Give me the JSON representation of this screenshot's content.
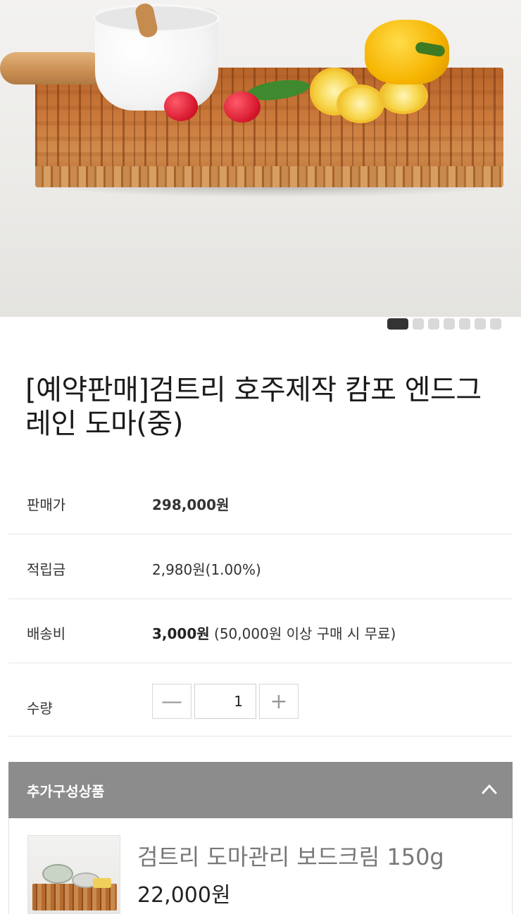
{
  "carousel": {
    "slide_count": 7,
    "active_index": 0
  },
  "product": {
    "title": "[예약판매]검트리 호주제작 캄포 엔드그레인 도마(중)"
  },
  "info": {
    "price_label": "판매가",
    "price_value": "298,000원",
    "points_label": "적립금",
    "points_value": "2,980원(1.00%)",
    "shipping_label": "배송비",
    "shipping_fee": "3,000원",
    "shipping_note": " (50,000원 이상 구매 시 무료)",
    "quantity_label": "수량",
    "quantity_value": "1",
    "minus_symbol": "—",
    "plus_symbol": "+"
  },
  "addon": {
    "section_title": "추가구성상품",
    "item_name": "검트리 도마관리 보드크림 150g",
    "item_price": "22,000원"
  },
  "colors": {
    "addon_header_bg": "#8c8c8c",
    "active_dot": "#333333",
    "inactive_dot": "#d9d9d9"
  },
  "icons": [
    "chevron-up-icon",
    "minus-icon",
    "plus-icon"
  ]
}
